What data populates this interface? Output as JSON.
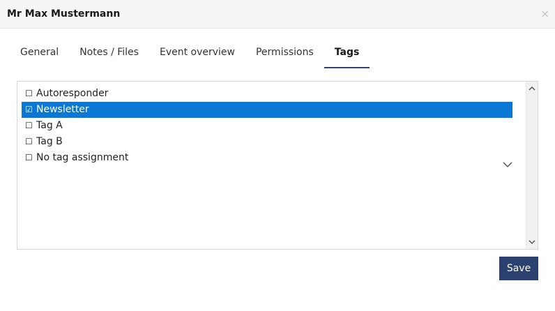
{
  "dialog": {
    "title": "Mr Max Mustermann",
    "close_icon": "×"
  },
  "tabs": [
    {
      "label": "General",
      "active": false
    },
    {
      "label": "Notes / Files",
      "active": false
    },
    {
      "label": "Event overview",
      "active": false
    },
    {
      "label": "Permissions",
      "active": false
    },
    {
      "label": "Tags",
      "active": true
    }
  ],
  "tags": {
    "items": [
      {
        "label": "Autoresponder",
        "checked": false,
        "mark": "☐"
      },
      {
        "label": "Newsletter",
        "checked": true,
        "mark": "☑"
      },
      {
        "label": "Tag A",
        "checked": false,
        "mark": "☐"
      },
      {
        "label": "Tag B",
        "checked": false,
        "mark": "☐"
      },
      {
        "label": "No tag assignment",
        "checked": false,
        "mark": "☐"
      }
    ],
    "selected_color": "#0a78d4"
  },
  "footer": {
    "save_label": "Save",
    "save_color": "#2b4170"
  },
  "icons": [
    "close-icon",
    "chevron-down-icon",
    "scroll-up-icon",
    "scroll-down-icon",
    "checkbox-icon"
  ]
}
